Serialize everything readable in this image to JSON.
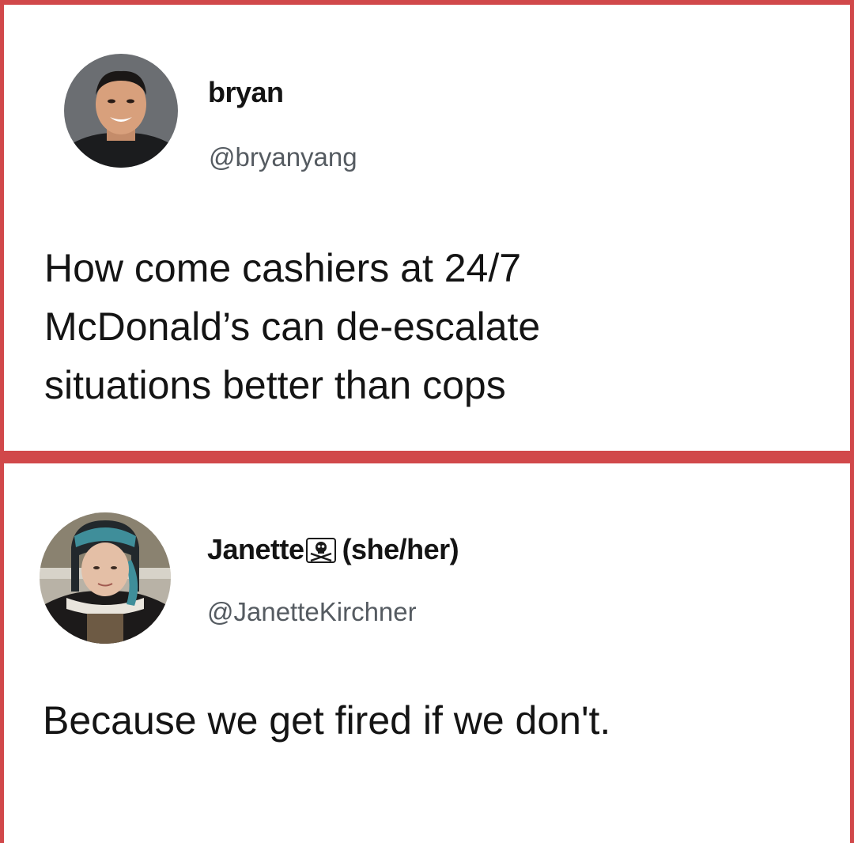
{
  "tweets": [
    {
      "display_name": "bryan",
      "handle": "@bryanyang",
      "text_lines": [
        "How come cashiers at 24/7",
        "McDonald’s can de-escalate",
        "situations better than cops"
      ]
    },
    {
      "display_name": "Janette",
      "name_icon": "skull-crossbones-icon",
      "pronouns": "(she/her)",
      "handle": "@JanetteKirchner",
      "text": "Because we get fired if we don't."
    }
  ],
  "colors": {
    "frame": "#d1484a",
    "text": "#141414",
    "handle": "#555b61"
  }
}
